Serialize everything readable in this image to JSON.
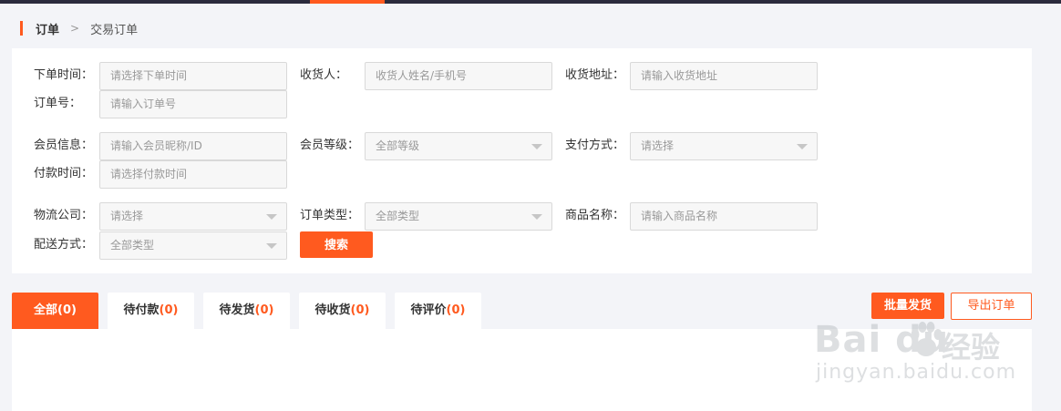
{
  "breadcrumb": {
    "level1": "订单",
    "separator": ">",
    "level2": "交易订单"
  },
  "filters": {
    "order_time": {
      "label": "下单时间：",
      "placeholder": "请选择下单时间"
    },
    "receiver": {
      "label": "收货人：",
      "placeholder": "收货人姓名/手机号"
    },
    "address": {
      "label": "收货地址：",
      "placeholder": "请输入收货地址"
    },
    "order_no": {
      "label": "订单号：",
      "placeholder": "请输入订单号"
    },
    "member_info": {
      "label": "会员信息：",
      "placeholder": "请输入会员昵称/ID"
    },
    "member_level": {
      "label": "会员等级：",
      "value": "全部等级"
    },
    "pay_method": {
      "label": "支付方式：",
      "value": "请选择"
    },
    "pay_time": {
      "label": "付款时间：",
      "placeholder": "请选择付款时间"
    },
    "logistics": {
      "label": "物流公司：",
      "value": "请选择"
    },
    "order_type": {
      "label": "订单类型：",
      "value": "全部类型"
    },
    "product_name": {
      "label": "商品名称：",
      "placeholder": "请输入商品名称"
    },
    "delivery": {
      "label": "配送方式：",
      "value": "全部类型"
    },
    "search_label": "搜索"
  },
  "tabs": [
    {
      "label": "全部",
      "count": "(0)"
    },
    {
      "label": "待付款",
      "count": "(0)"
    },
    {
      "label": "待发货",
      "count": "(0)"
    },
    {
      "label": "待收货",
      "count": "(0)"
    },
    {
      "label": "待评价",
      "count": "(0)"
    }
  ],
  "actions": {
    "batch_ship": "批量发货",
    "export": "导出订单"
  },
  "watermark": {
    "logo": "Bai du",
    "cn": "经验",
    "url": "jingyan.baidu.com"
  },
  "colors": {
    "accent": "#ff5a1f",
    "topbar": "#2b2b3d",
    "page_bg": "#f3f4f8"
  }
}
